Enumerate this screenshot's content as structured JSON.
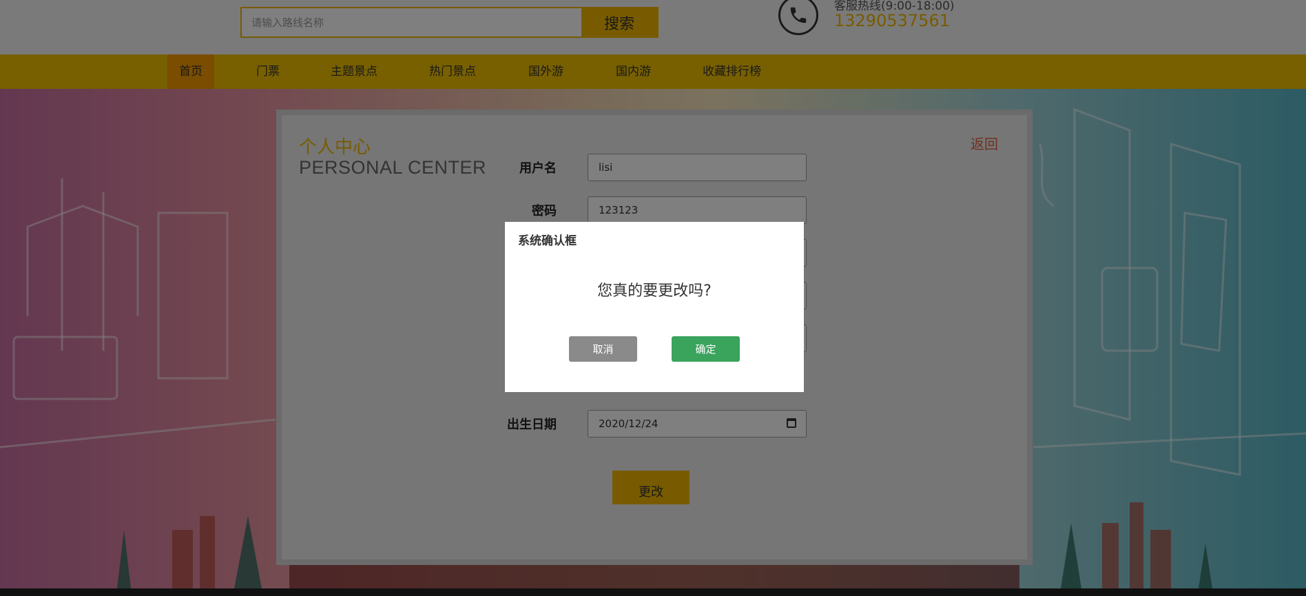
{
  "header": {
    "search_placeholder": "请输入路线名称",
    "search_button": "搜索",
    "hotline_label": "客服热线(9:00-18:00)",
    "hotline_number": "13290537561",
    "icon": "phone-icon"
  },
  "nav": {
    "items": [
      {
        "label": "首页",
        "active": true
      },
      {
        "label": "门票"
      },
      {
        "label": "主题景点"
      },
      {
        "label": "热门景点"
      },
      {
        "label": "国外游"
      },
      {
        "label": "国内游"
      },
      {
        "label": "收藏排行榜"
      }
    ]
  },
  "page": {
    "title_cn": "个人中心",
    "title_en": "PERSONAL CENTER",
    "back_link": "返回"
  },
  "form": {
    "username_label": "用户名",
    "username_value": "lisi",
    "password_label": "密码",
    "password_value": "123123",
    "birthdate_label": "出生日期",
    "birthdate_value": "2020/12/24",
    "submit_button": "更改"
  },
  "dialog": {
    "title": "系统确认框",
    "message": "您真的要更改吗?",
    "cancel_button": "取消",
    "confirm_button": "确定"
  },
  "colors": {
    "accent": "#f0b700",
    "nav_active": "#f59b00",
    "back_link": "#e0603c",
    "confirm": "#3aa35c",
    "cancel": "#8a8a8a"
  }
}
